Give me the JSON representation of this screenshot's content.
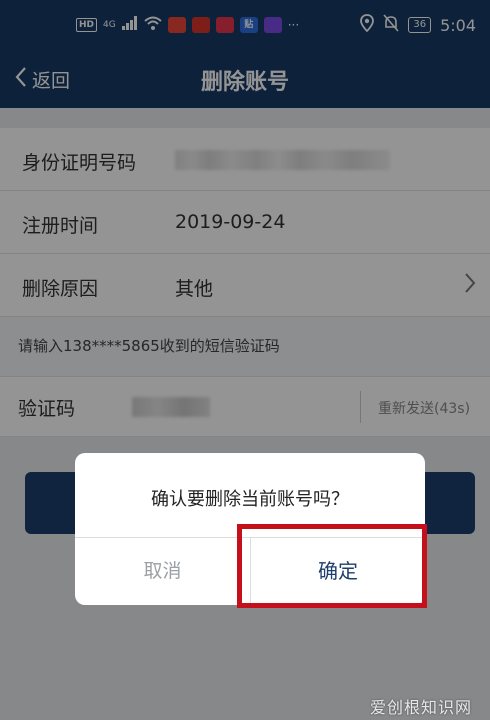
{
  "status_bar": {
    "hd": "HD",
    "network": "4G",
    "battery": "36",
    "time": "5:04",
    "more": "···",
    "app_icons": [
      {
        "name": "app-icon-1",
        "color": "#e8463a",
        "label": ""
      },
      {
        "name": "app-icon-2",
        "color": "#d9352b",
        "label": ""
      },
      {
        "name": "app-icon-3",
        "color": "#e7344a",
        "label": ""
      },
      {
        "name": "app-icon-4",
        "color": "#2c6fe0",
        "label": "贴"
      },
      {
        "name": "app-icon-5",
        "color": "#7b4be6",
        "label": ""
      }
    ]
  },
  "header": {
    "back_label": "返回",
    "title": "删除账号"
  },
  "form": {
    "id_label": "身份证明号码",
    "register_label": "注册时间",
    "register_value": "2019-09-24",
    "reason_label": "删除原因",
    "reason_value": "其他",
    "hint": "请输入138****5865收到的短信验证码",
    "code_label": "验证码",
    "resend": "重新发送(43s)"
  },
  "dialog": {
    "message": "确认要删除当前账号吗？",
    "cancel": "取消",
    "confirm": "确定"
  },
  "colors": {
    "header_bg": "#173a67",
    "highlight": "#c3101a",
    "confirm_text": "#1f3f6d"
  },
  "watermark": "爱创根知识网"
}
